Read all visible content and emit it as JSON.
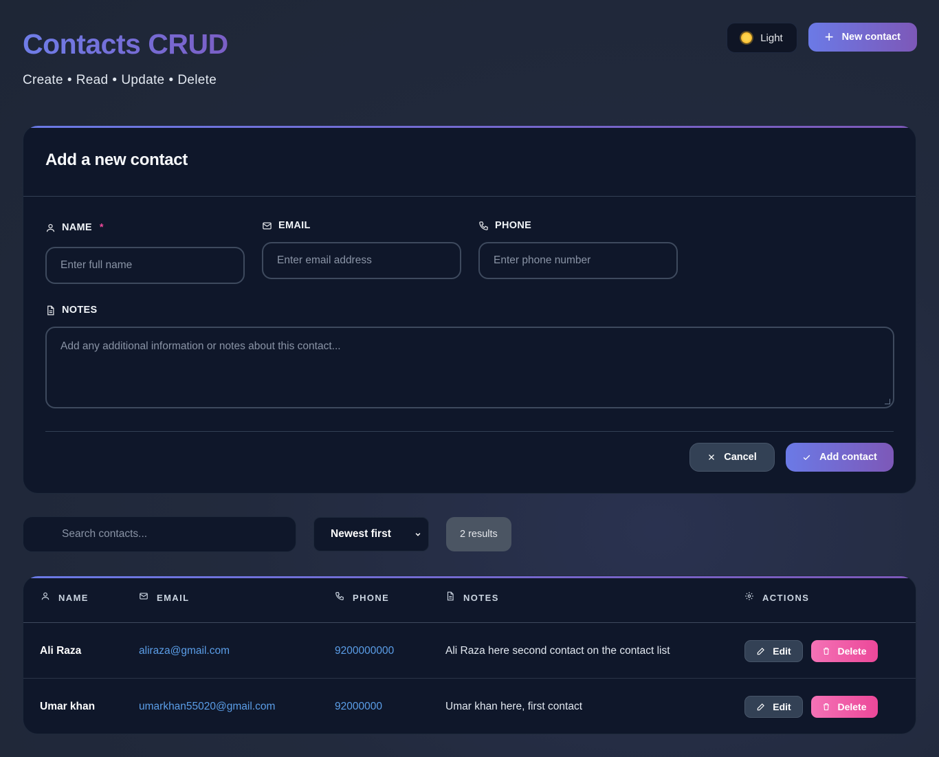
{
  "header": {
    "title": "Contacts CRUD",
    "subtitle_parts": [
      "Create",
      "Read",
      "Update",
      "Delete"
    ],
    "separator": "•",
    "theme_toggle_label": "Light",
    "new_contact_label": "New contact"
  },
  "form": {
    "title": "Add a new contact",
    "name": {
      "label": "NAME",
      "required_mark": "*",
      "placeholder": "Enter full name"
    },
    "email": {
      "label": "EMAIL",
      "placeholder": "Enter email address"
    },
    "phone": {
      "label": "PHONE",
      "placeholder": "Enter phone number"
    },
    "notes": {
      "label": "NOTES",
      "placeholder": "Add any additional information or notes about this contact..."
    },
    "cancel_label": "Cancel",
    "submit_label": "Add contact"
  },
  "toolbar": {
    "search_placeholder": "Search contacts...",
    "sort_selected": "Newest first",
    "results_label": "2 results"
  },
  "table": {
    "columns": [
      "NAME",
      "EMAIL",
      "PHONE",
      "NOTES",
      "ACTIONS"
    ],
    "rows": [
      {
        "name": "Ali Raza",
        "email": "aliraza@gmail.com",
        "phone": "9200000000",
        "notes": "Ali Raza here second contact on the contact list",
        "edit": "Edit",
        "delete": "Delete"
      },
      {
        "name": "Umar khan",
        "email": "umarkhan55020@gmail.com",
        "phone": "92000000",
        "notes": "Umar khan here, first contact",
        "edit": "Edit",
        "delete": "Delete"
      }
    ]
  },
  "colors": {
    "accent_start": "#6b7ae6",
    "accent_end": "#7d58b8",
    "danger": "#ec4899",
    "link": "#5b9ee8",
    "card_bg": "#0f172a"
  }
}
